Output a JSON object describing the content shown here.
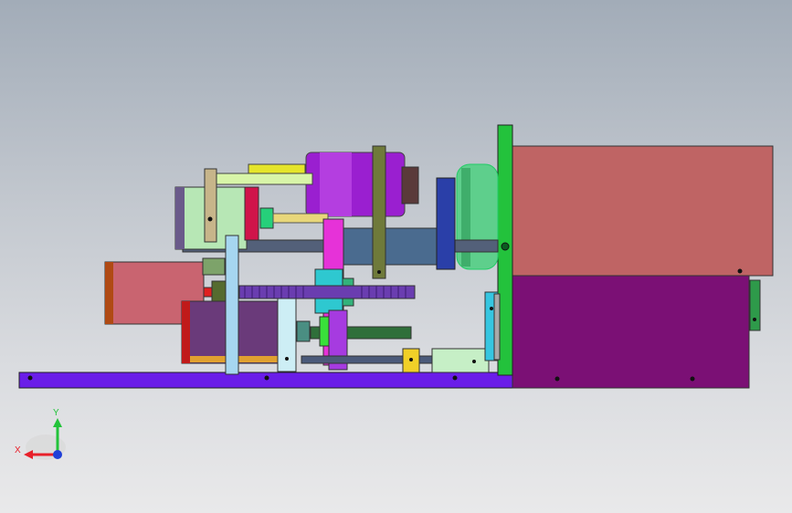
{
  "window": {
    "title": ""
  },
  "triad": {
    "x_label": "X",
    "y_label": "Y",
    "x_color": "#e8202a",
    "y_color": "#22c33a",
    "z_color": "#1f3fd8"
  },
  "colors": {
    "background_top": "#a2acb8",
    "background_bottom": "#e9e9ea",
    "base_plate": "#6a1de8",
    "motor_housing_upper": "#bf6464",
    "motor_housing_lower": "#7b1075",
    "vertical_frame": "#23c23c",
    "gear_housing": "#9a1fd0",
    "shaft": "#536079"
  }
}
